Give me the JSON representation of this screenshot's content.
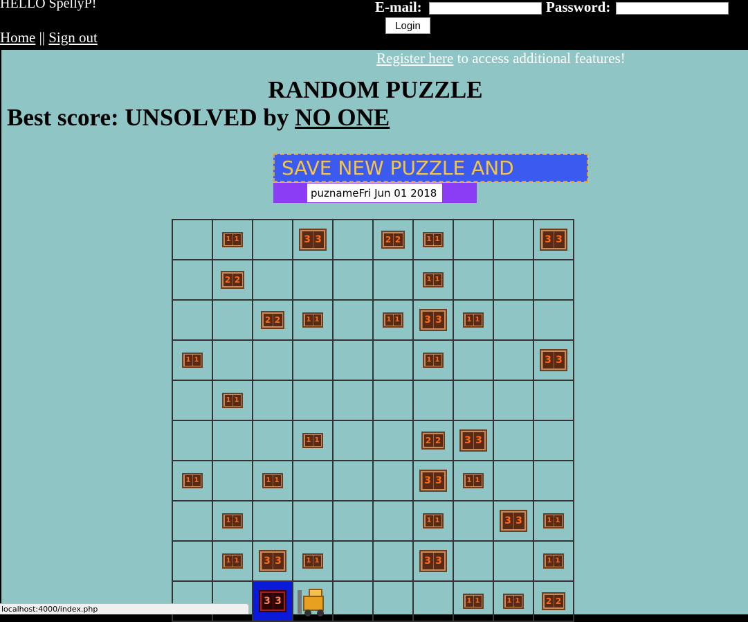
{
  "header": {
    "greeting": "HELLO SpellyP!",
    "email_label": "E-mail:",
    "password_label": "Password:",
    "email_value": "",
    "password_value": "",
    "login_label": "Login",
    "nav": {
      "home": "Home",
      "separator": " || ",
      "signout": "Sign out"
    }
  },
  "register": {
    "link": "Register here",
    "text": " to access additional features!"
  },
  "puzzle": {
    "title": "RANDOM PUZZLE",
    "best_prefix": "Best score: UNSOLVED by ",
    "best_holder": "NO ONE",
    "save_label": "SAVE NEW PUZZLE AND SCORE",
    "name_value": "puznameFri Jun 01 2018"
  },
  "board": {
    "cols": 10,
    "rows": 10,
    "cells": [
      [
        0,
        1,
        0,
        3,
        0,
        2,
        1,
        0,
        0,
        3
      ],
      [
        0,
        2,
        0,
        0,
        0,
        0,
        1,
        0,
        0,
        0
      ],
      [
        0,
        0,
        2,
        1,
        0,
        1,
        3,
        1,
        0,
        0
      ],
      [
        1,
        0,
        0,
        0,
        0,
        0,
        1,
        0,
        0,
        3
      ],
      [
        0,
        1,
        0,
        0,
        0,
        0,
        0,
        0,
        0,
        0
      ],
      [
        0,
        0,
        0,
        1,
        0,
        0,
        2,
        3,
        0,
        0
      ],
      [
        1,
        0,
        1,
        0,
        0,
        0,
        3,
        1,
        0,
        0
      ],
      [
        0,
        1,
        0,
        0,
        0,
        0,
        1,
        0,
        3,
        1
      ],
      [
        0,
        1,
        3,
        1,
        0,
        0,
        3,
        0,
        0,
        1
      ],
      [
        0,
        0,
        3,
        "F",
        0,
        0,
        0,
        1,
        1,
        2
      ]
    ],
    "selected_cell": [
      9,
      2
    ]
  },
  "status": {
    "url": "localhost:4000/index.php"
  }
}
